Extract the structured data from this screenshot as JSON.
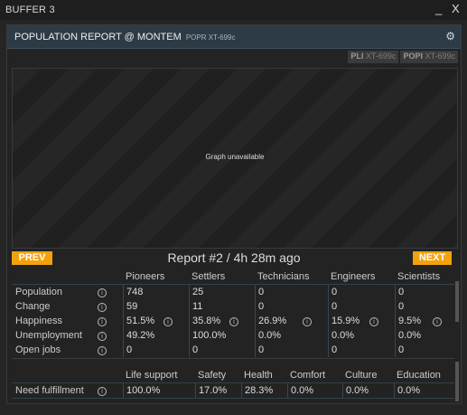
{
  "window": {
    "title": "BUFFER 3",
    "minimize": "_",
    "close": "X"
  },
  "report": {
    "title": "POPULATION REPORT @ MONTEM",
    "code": "POPR XT-699c",
    "commands": [
      {
        "prefix": "PLI",
        "arg": "XT-699c"
      },
      {
        "prefix": "POPI",
        "arg": "XT-699c"
      }
    ],
    "graph_message": "Graph unavailable",
    "prev_label": "PREV",
    "next_label": "NEXT",
    "report_label": "Report #2 / 4h 28m ago"
  },
  "population_table": {
    "columns": [
      "Pioneers",
      "Settlers",
      "Technicians",
      "Engineers",
      "Scientists"
    ],
    "rows": [
      {
        "label": "Population",
        "values": [
          "748",
          "25",
          "0",
          "0",
          "0"
        ]
      },
      {
        "label": "Change",
        "values": [
          "59",
          "11",
          "0",
          "0",
          "0"
        ]
      },
      {
        "label": "Happiness",
        "values": [
          "51.5%",
          "35.8%",
          "26.9%",
          "15.9%",
          "9.5%"
        ]
      },
      {
        "label": "Unemployment",
        "values": [
          "49.2%",
          "100.0%",
          "0.0%",
          "0.0%",
          "0.0%"
        ]
      },
      {
        "label": "Open jobs",
        "values": [
          "0",
          "0",
          "0",
          "0",
          "0"
        ]
      }
    ]
  },
  "needs_table": {
    "columns": [
      "Life support",
      "Safety",
      "Health",
      "Comfort",
      "Culture",
      "Education"
    ],
    "rows": [
      {
        "label": "Need fulfillment",
        "values": [
          "100.0%",
          "17.0%",
          "28.3%",
          "0.0%",
          "0.0%",
          "0.0%"
        ]
      }
    ]
  },
  "colors": {
    "accent": "#f3a20d",
    "header": "#2d3b46",
    "background": "#252525"
  }
}
